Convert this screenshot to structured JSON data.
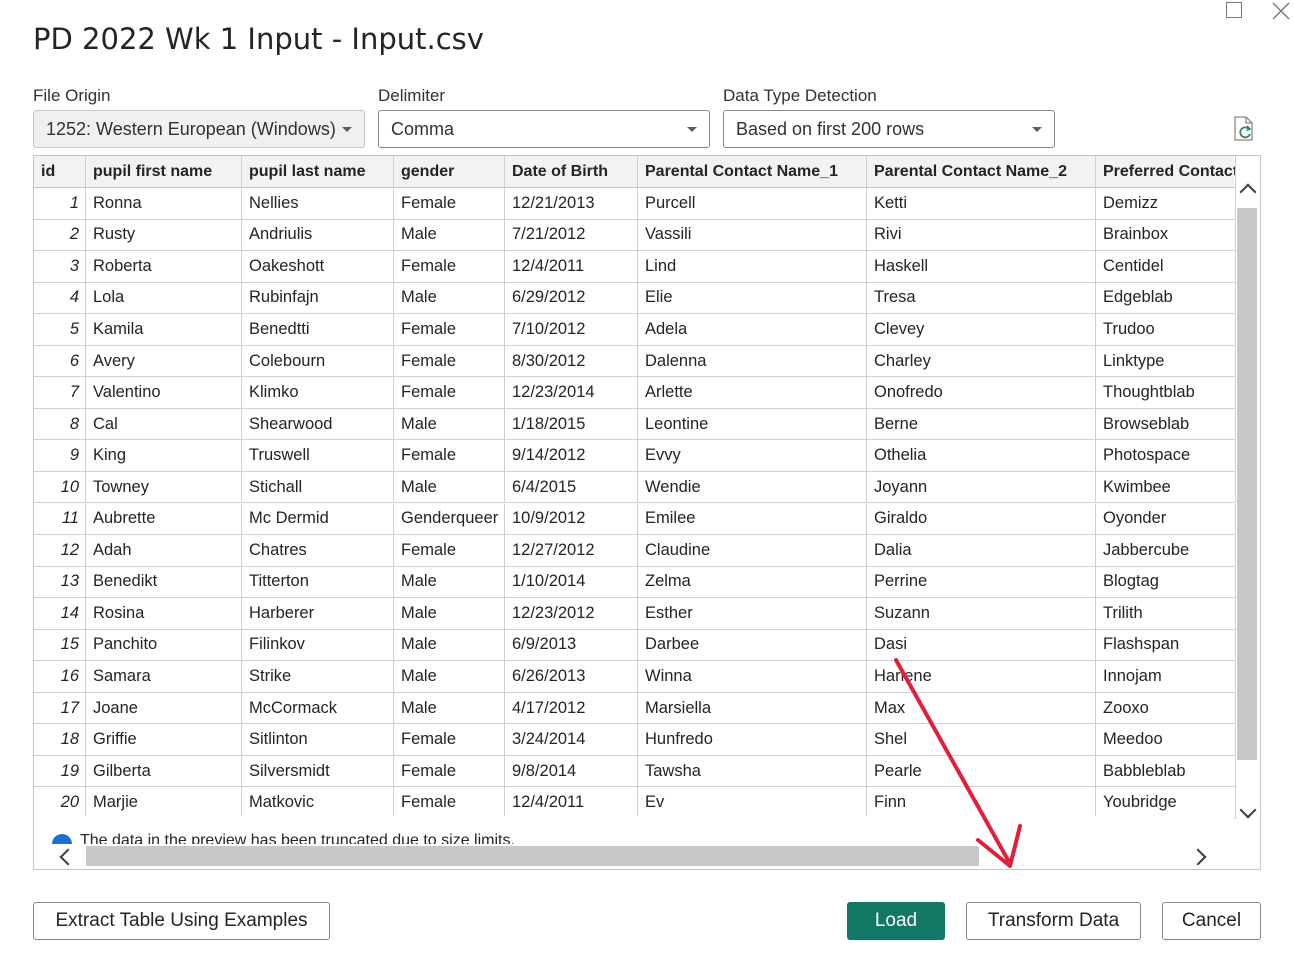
{
  "dialog": {
    "title": "PD 2022 Wk 1 Input - Input.csv"
  },
  "controls": {
    "file_origin": {
      "label": "File Origin",
      "value": "1252: Western European (Windows)"
    },
    "delimiter": {
      "label": "Delimiter",
      "value": "Comma"
    },
    "data_type_detection": {
      "label": "Data Type Detection",
      "value": "Based on first 200 rows"
    }
  },
  "table": {
    "columns": [
      "id",
      "pupil first name",
      "pupil last name",
      "gender",
      "Date of Birth",
      "Parental Contact Name_1",
      "Parental Contact Name_2",
      "Preferred Contact"
    ],
    "rows": [
      [
        "1",
        "Ronna",
        "Nellies",
        "Female",
        "12/21/2013",
        "Purcell",
        "Ketti",
        "Demizz"
      ],
      [
        "2",
        "Rusty",
        "Andriulis",
        "Male",
        "7/21/2012",
        "Vassili",
        "Rivi",
        "Brainbox"
      ],
      [
        "3",
        "Roberta",
        "Oakeshott",
        "Female",
        "12/4/2011",
        "Lind",
        "Haskell",
        "Centidel"
      ],
      [
        "4",
        "Lola",
        "Rubinfajn",
        "Male",
        "6/29/2012",
        "Elie",
        "Tresa",
        "Edgeblab"
      ],
      [
        "5",
        "Kamila",
        "Benedtti",
        "Female",
        "7/10/2012",
        "Adela",
        "Clevey",
        "Trudoo"
      ],
      [
        "6",
        "Avery",
        "Colebourn",
        "Female",
        "8/30/2012",
        "Dalenna",
        "Charley",
        "Linktype"
      ],
      [
        "7",
        "Valentino",
        "Klimko",
        "Female",
        "12/23/2014",
        "Arlette",
        "Onofredo",
        "Thoughtblab"
      ],
      [
        "8",
        "Cal",
        "Shearwood",
        "Male",
        "1/18/2015",
        "Leontine",
        "Berne",
        "Browseblab"
      ],
      [
        "9",
        "King",
        "Truswell",
        "Female",
        "9/14/2012",
        "Evvy",
        "Othelia",
        "Photospace"
      ],
      [
        "10",
        "Towney",
        "Stichall",
        "Male",
        "6/4/2015",
        "Wendie",
        "Joyann",
        "Kwimbee"
      ],
      [
        "11",
        "Aubrette",
        "Mc Dermid",
        "Genderqueer",
        "10/9/2012",
        "Emilee",
        "Giraldo",
        "Oyonder"
      ],
      [
        "12",
        "Adah",
        "Chatres",
        "Female",
        "12/27/2012",
        "Claudine",
        "Dalia",
        "Jabbercube"
      ],
      [
        "13",
        "Benedikt",
        "Titterton",
        "Male",
        "1/10/2014",
        "Zelma",
        "Perrine",
        "Blogtag"
      ],
      [
        "14",
        "Rosina",
        "Harberer",
        "Male",
        "12/23/2012",
        "Esther",
        "Suzann",
        "Trilith"
      ],
      [
        "15",
        "Panchito",
        "Filinkov",
        "Male",
        "6/9/2013",
        "Darbee",
        "Dasi",
        "Flashspan"
      ],
      [
        "16",
        "Samara",
        "Strike",
        "Male",
        "6/26/2013",
        "Winna",
        "Harlene",
        "Innojam"
      ],
      [
        "17",
        "Joane",
        "McCormack",
        "Male",
        "4/17/2012",
        "Marsiella",
        "Max",
        "Zooxo"
      ],
      [
        "18",
        "Griffie",
        "Sitlinton",
        "Female",
        "3/24/2014",
        "Hunfredo",
        "Shel",
        "Meedoo"
      ],
      [
        "19",
        "Gilberta",
        "Silversmidt",
        "Female",
        "9/8/2014",
        "Tawsha",
        "Pearle",
        "Babbleblab"
      ],
      [
        "20",
        "Marjie",
        "Matkovic",
        "Female",
        "12/4/2011",
        "Ev",
        "Finn",
        "Youbridge"
      ]
    ]
  },
  "info_message": "The data in the preview has been truncated due to size limits.",
  "buttons": {
    "extract": "Extract Table Using Examples",
    "load": "Load",
    "transform": "Transform Data",
    "cancel": "Cancel"
  },
  "colors": {
    "primary": "#117865",
    "annotation_arrow": "#e0203a",
    "info_icon": "#1f6fd1"
  },
  "icons": [
    "maximize-icon",
    "close-icon",
    "refresh-icon",
    "info-icon",
    "chevron-up-icon",
    "chevron-down-icon",
    "chevron-left-icon",
    "chevron-right-icon"
  ]
}
